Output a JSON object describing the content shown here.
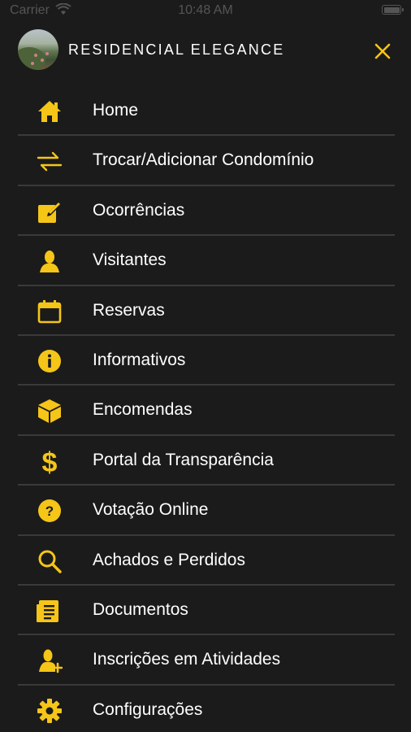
{
  "status_bar": {
    "carrier": "Carrier",
    "time": "10:48 AM"
  },
  "header": {
    "title": "RESIDENCIAL ELEGANCE",
    "avatar_icon": "condominium-photo",
    "close_icon": "close-icon"
  },
  "colors": {
    "accent": "#f5c518",
    "background": "#1b1b1b",
    "divider": "#3a3a3a",
    "text": "#ffffff"
  },
  "menu": {
    "items": [
      {
        "label": "Home",
        "icon": "home-icon"
      },
      {
        "label": "Trocar/Adicionar Condomínio",
        "icon": "swap-icon"
      },
      {
        "label": "Ocorrências",
        "icon": "edit-icon"
      },
      {
        "label": "Visitantes",
        "icon": "person-icon"
      },
      {
        "label": "Reservas",
        "icon": "calendar-icon"
      },
      {
        "label": "Informativos",
        "icon": "info-icon"
      },
      {
        "label": "Encomendas",
        "icon": "package-icon"
      },
      {
        "label": "Portal da Transparência",
        "icon": "dollar-icon"
      },
      {
        "label": "Votação Online",
        "icon": "question-icon"
      },
      {
        "label": "Achados e Perdidos",
        "icon": "search-icon"
      },
      {
        "label": "Documentos",
        "icon": "document-icon"
      },
      {
        "label": "Inscrições em Atividades",
        "icon": "person-add-icon"
      },
      {
        "label": "Configurações",
        "icon": "gear-icon"
      }
    ]
  }
}
